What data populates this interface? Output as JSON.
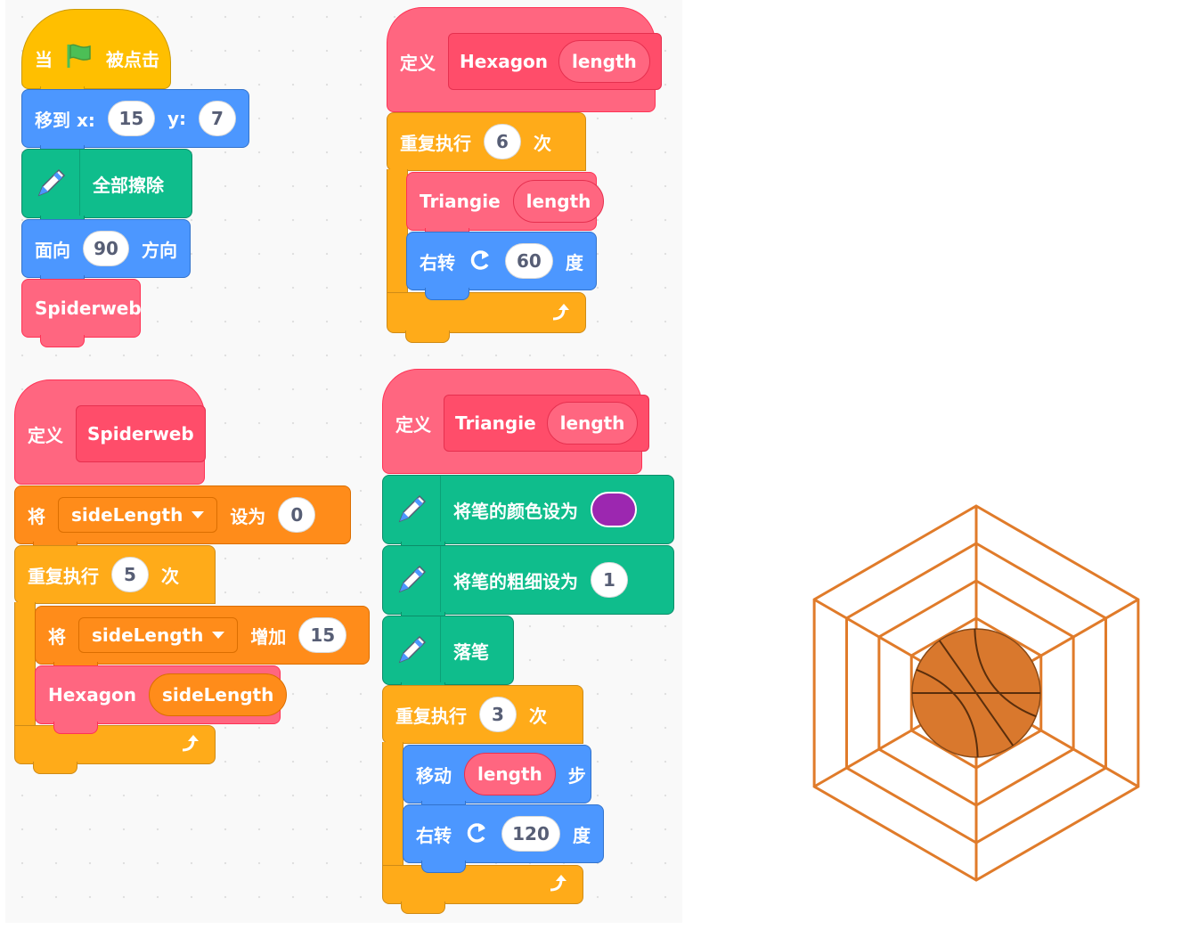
{
  "script_flag": {
    "hat": {
      "when": "当",
      "clicked": "被点击"
    },
    "goto": {
      "label": "移到 x:",
      "x": "15",
      "y_label": "y:",
      "y": "7"
    },
    "clear": {
      "label": "全部擦除"
    },
    "point": {
      "label": "面向",
      "value": "90",
      "suffix": "方向"
    },
    "call": {
      "label": "Spiderweb"
    }
  },
  "def_hexagon": {
    "define": "定义",
    "name": "Hexagon",
    "arg": "length",
    "repeat": {
      "label": "重复执行",
      "count": "6",
      "suffix": "次"
    },
    "call_triangle": {
      "name": "Triangie",
      "arg": "length"
    },
    "turn": {
      "label": "右转",
      "value": "60",
      "suffix": "度"
    }
  },
  "def_spiderweb": {
    "define": "定义",
    "name": "Spiderweb",
    "set": {
      "label": "将",
      "var": "sideLength",
      "to": "设为",
      "value": "0"
    },
    "repeat": {
      "label": "重复执行",
      "count": "5",
      "suffix": "次"
    },
    "change": {
      "label": "将",
      "var": "sideLength",
      "by": "增加",
      "value": "15"
    },
    "call_hexagon": {
      "name": "Hexagon",
      "arg": "sideLength"
    }
  },
  "def_triangle": {
    "define": "定义",
    "name": "Triangie",
    "arg": "length",
    "pen_color": {
      "label": "将笔的颜色设为",
      "color": "#9c27b0"
    },
    "pen_size": {
      "label": "将笔的粗细设为",
      "value": "1"
    },
    "pen_down": {
      "label": "落笔"
    },
    "repeat": {
      "label": "重复执行",
      "count": "3",
      "suffix": "次"
    },
    "move": {
      "label": "移动",
      "arg": "length",
      "suffix": "步"
    },
    "turn": {
      "label": "右转",
      "value": "120",
      "suffix": "度"
    }
  },
  "colors": {
    "events": "#ffbf00",
    "motion": "#4c97ff",
    "pen": "#0fbd8c",
    "custom": "#ff6680",
    "control": "#ffab19",
    "variables": "#ff8c1a",
    "web_line": "#e07b2a",
    "ball": "#d9782d"
  },
  "stage": {
    "rings": 5,
    "ring_step": 15,
    "ring_start": 15
  }
}
